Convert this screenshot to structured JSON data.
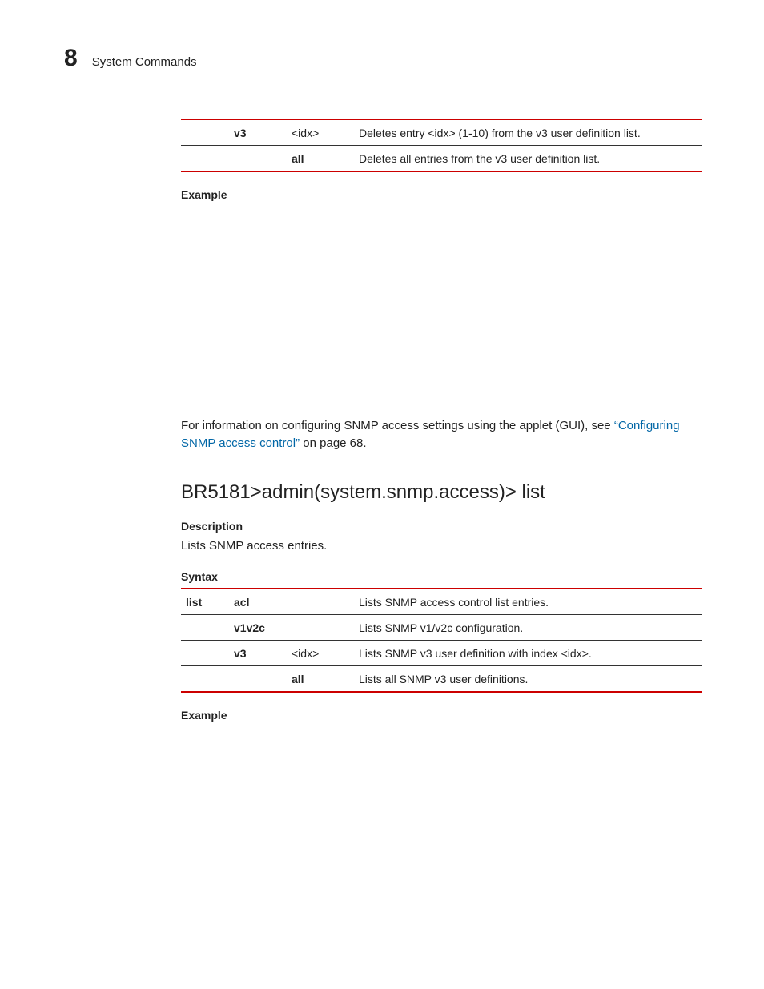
{
  "header": {
    "chapter_number": "8",
    "chapter_title": "System Commands"
  },
  "table1": {
    "rows": [
      {
        "c0": "",
        "c1": "v3",
        "c2": "<idx>",
        "c3": "Deletes entry <idx> (1-10) from the v3 user definition list."
      },
      {
        "c0": "",
        "c1": "",
        "c2": "all",
        "c3": "Deletes all entries from the v3 user definition list."
      }
    ]
  },
  "example1_label": "Example",
  "crossref": {
    "pre": "For information on configuring SNMP access settings using the applet (GUI), see ",
    "link": "“Configuring SNMP access control”",
    "post": " on page 68."
  },
  "command_title": "BR5181>admin(system.snmp.access)> list",
  "description_label": "Description",
  "description_text": "Lists SNMP access entries.",
  "syntax_label": "Syntax",
  "table2": {
    "rows": [
      {
        "c0": "list",
        "c1": "acl",
        "c2": "",
        "c3": "Lists SNMP access control list entries."
      },
      {
        "c0": "",
        "c1": "v1v2c",
        "c2": "",
        "c3": "Lists SNMP v1/v2c configuration."
      },
      {
        "c0": "",
        "c1": "v3",
        "c2": "<idx>",
        "c3": "Lists SNMP v3 user definition with index <idx>."
      },
      {
        "c0": "",
        "c1": "",
        "c2": "all",
        "c3": "Lists all SNMP v3 user definitions."
      }
    ]
  },
  "example2_label": "Example"
}
